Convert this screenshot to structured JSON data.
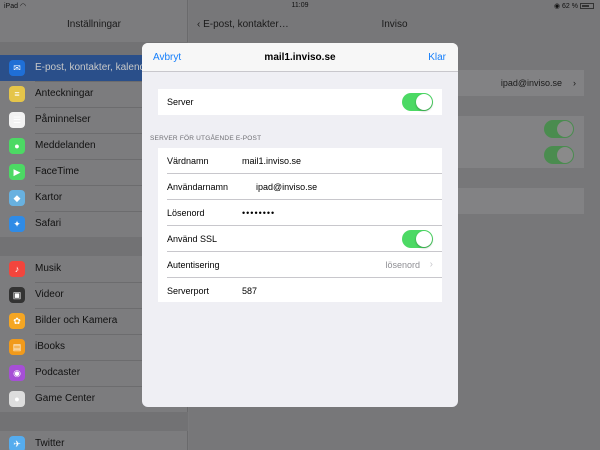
{
  "status": {
    "device": "iPad",
    "wifi_icon": "wifi-icon",
    "time": "11:09",
    "battery": "62 %"
  },
  "sidebar": {
    "title": "Inställningar",
    "items": [
      {
        "label": "E-post, kontakter, kalendrar",
        "icon": "mail-icon",
        "color": "#1f6fd6",
        "active": true
      },
      {
        "label": "Anteckningar",
        "icon": "notes-icon",
        "color": "#e5c54a"
      },
      {
        "label": "Påminnelser",
        "icon": "reminders-icon",
        "color": "#f2f2f2"
      },
      {
        "label": "Meddelanden",
        "icon": "messages-icon",
        "color": "#4cd964"
      },
      {
        "label": "FaceTime",
        "icon": "facetime-icon",
        "color": "#4cd964"
      },
      {
        "label": "Kartor",
        "icon": "maps-icon",
        "color": "#68b1e0"
      },
      {
        "label": "Safari",
        "icon": "safari-icon",
        "color": "#2f8be6"
      },
      {
        "label": "Musik",
        "icon": "music-icon",
        "color": "#f2453d"
      },
      {
        "label": "Videor",
        "icon": "videos-icon",
        "color": "#333333"
      },
      {
        "label": "Bilder och Kamera",
        "icon": "photos-icon",
        "color": "#f5a623"
      },
      {
        "label": "iBooks",
        "icon": "ibooks-icon",
        "color": "#f19a1b"
      },
      {
        "label": "Podcaster",
        "icon": "podcasts-icon",
        "color": "#a64fd6"
      },
      {
        "label": "Game Center",
        "icon": "gamecenter-icon",
        "color": "#dddddd"
      },
      {
        "label": "Twitter",
        "icon": "twitter-icon",
        "color": "#55acee"
      }
    ]
  },
  "detail": {
    "back_label": "E-post, kontakter…",
    "title": "Inviso",
    "account_value": "ipad@inviso.se"
  },
  "modal": {
    "cancel_label": "Avbryt",
    "title": "mail1.inviso.se",
    "done_label": "Klar",
    "server_label": "Server",
    "server_enabled": true,
    "section_header": "SERVER FÖR UTGÅENDE E-POST",
    "fields": {
      "hostname_label": "Värdnamn",
      "hostname_value": "mail1.inviso.se",
      "username_label": "Användarnamn",
      "username_value": "ipad@inviso.se",
      "password_label": "Lösenord",
      "password_value": "••••••••",
      "ssl_label": "Använd SSL",
      "ssl_enabled": true,
      "auth_label": "Autentisering",
      "auth_value": "lösenord",
      "port_label": "Serverport",
      "port_value": "587"
    },
    "accent_color": "#147efb",
    "toggle_on_color": "#4cd964"
  }
}
